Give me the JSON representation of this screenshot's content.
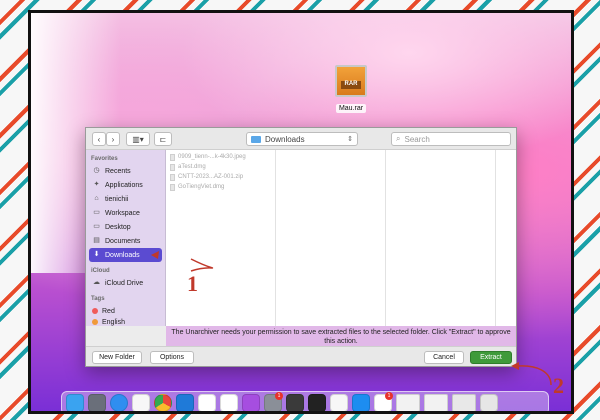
{
  "desktop": {
    "file": {
      "name": "Mau.rar",
      "icon_label": "RAR",
      "icon": "rar-archive-icon"
    }
  },
  "dialog": {
    "toolbar": {
      "back_icon": "chevron-left-icon",
      "forward_icon": "chevron-right-icon",
      "view_icon": "column-view-icon",
      "new_folder_icon": "folder-icon",
      "location": "Downloads",
      "search_placeholder": "Search"
    },
    "sidebar": {
      "favorites_heading": "Favorites",
      "favorites": [
        {
          "label": "Recents",
          "icon": "clock-icon"
        },
        {
          "label": "Applications",
          "icon": "applications-icon"
        },
        {
          "label": "tienichii",
          "icon": "home-icon"
        },
        {
          "label": "Workspace",
          "icon": "folder-icon"
        },
        {
          "label": "Desktop",
          "icon": "desktop-icon"
        },
        {
          "label": "Documents",
          "icon": "document-icon"
        },
        {
          "label": "Downloads",
          "icon": "download-icon"
        }
      ],
      "selected_index": 6,
      "icloud_heading": "iCloud",
      "icloud": [
        {
          "label": "iCloud Drive",
          "icon": "cloud-icon"
        }
      ],
      "tags_heading": "Tags",
      "tags": [
        {
          "label": "Red",
          "color": "#f05a5a"
        },
        {
          "label": "English",
          "color": "#f09a3a"
        }
      ]
    },
    "files": [
      "0909_tienn-...k-4k30.jpeg",
      "aTest.dmg",
      "CNTT-2023...AZ-001.zip",
      "GoTiengViet.dmg"
    ],
    "notice": "The Unarchiver needs your permission to save extracted files to the selected folder. Click \"Extract\" to approve this action.",
    "buttons": {
      "new_folder": "New Folder",
      "options": "Options",
      "cancel": "Cancel",
      "extract": "Extract"
    }
  },
  "annotations": {
    "one": "1",
    "two": "2"
  },
  "dock": {
    "apps": [
      {
        "name": "finder-icon",
        "color": "#3aa3f0"
      },
      {
        "name": "launchpad-icon",
        "color": "#6a6f7a"
      },
      {
        "name": "safari-icon",
        "color": "#2f8ef0"
      },
      {
        "name": "notes-icon",
        "color": "#f7f7f7"
      },
      {
        "name": "chrome-icon",
        "color": "#f2f2f2"
      },
      {
        "name": "vscode-icon",
        "color": "#1f7ad8"
      },
      {
        "name": "zalo-icon",
        "color": "#ffffff"
      },
      {
        "name": "messenger-icon",
        "color": "#ffffff"
      },
      {
        "name": "podcasts-icon",
        "color": "#a64ee0"
      },
      {
        "name": "system-preferences-icon",
        "color": "#8a8f98"
      },
      {
        "name": "calculator-icon",
        "color": "#3a3a3a"
      },
      {
        "name": "terminal-icon",
        "color": "#222222"
      },
      {
        "name": "textedit-icon",
        "color": "#f7f7f7"
      },
      {
        "name": "app-store-icon",
        "color": "#1d8df0"
      },
      {
        "name": "calendar-icon",
        "color": "#ffffff"
      },
      {
        "name": "window-thumbnail-icon",
        "color": "#f2f2f2"
      },
      {
        "name": "window-thumbnail-icon",
        "color": "#f2f2f2"
      },
      {
        "name": "window-thumbnail-icon",
        "color": "#e8e8e8"
      },
      {
        "name": "trash-icon",
        "color": "#e6e6e6"
      }
    ],
    "badges": {
      "system-preferences-icon": "1",
      "calendar-icon": "1"
    }
  }
}
